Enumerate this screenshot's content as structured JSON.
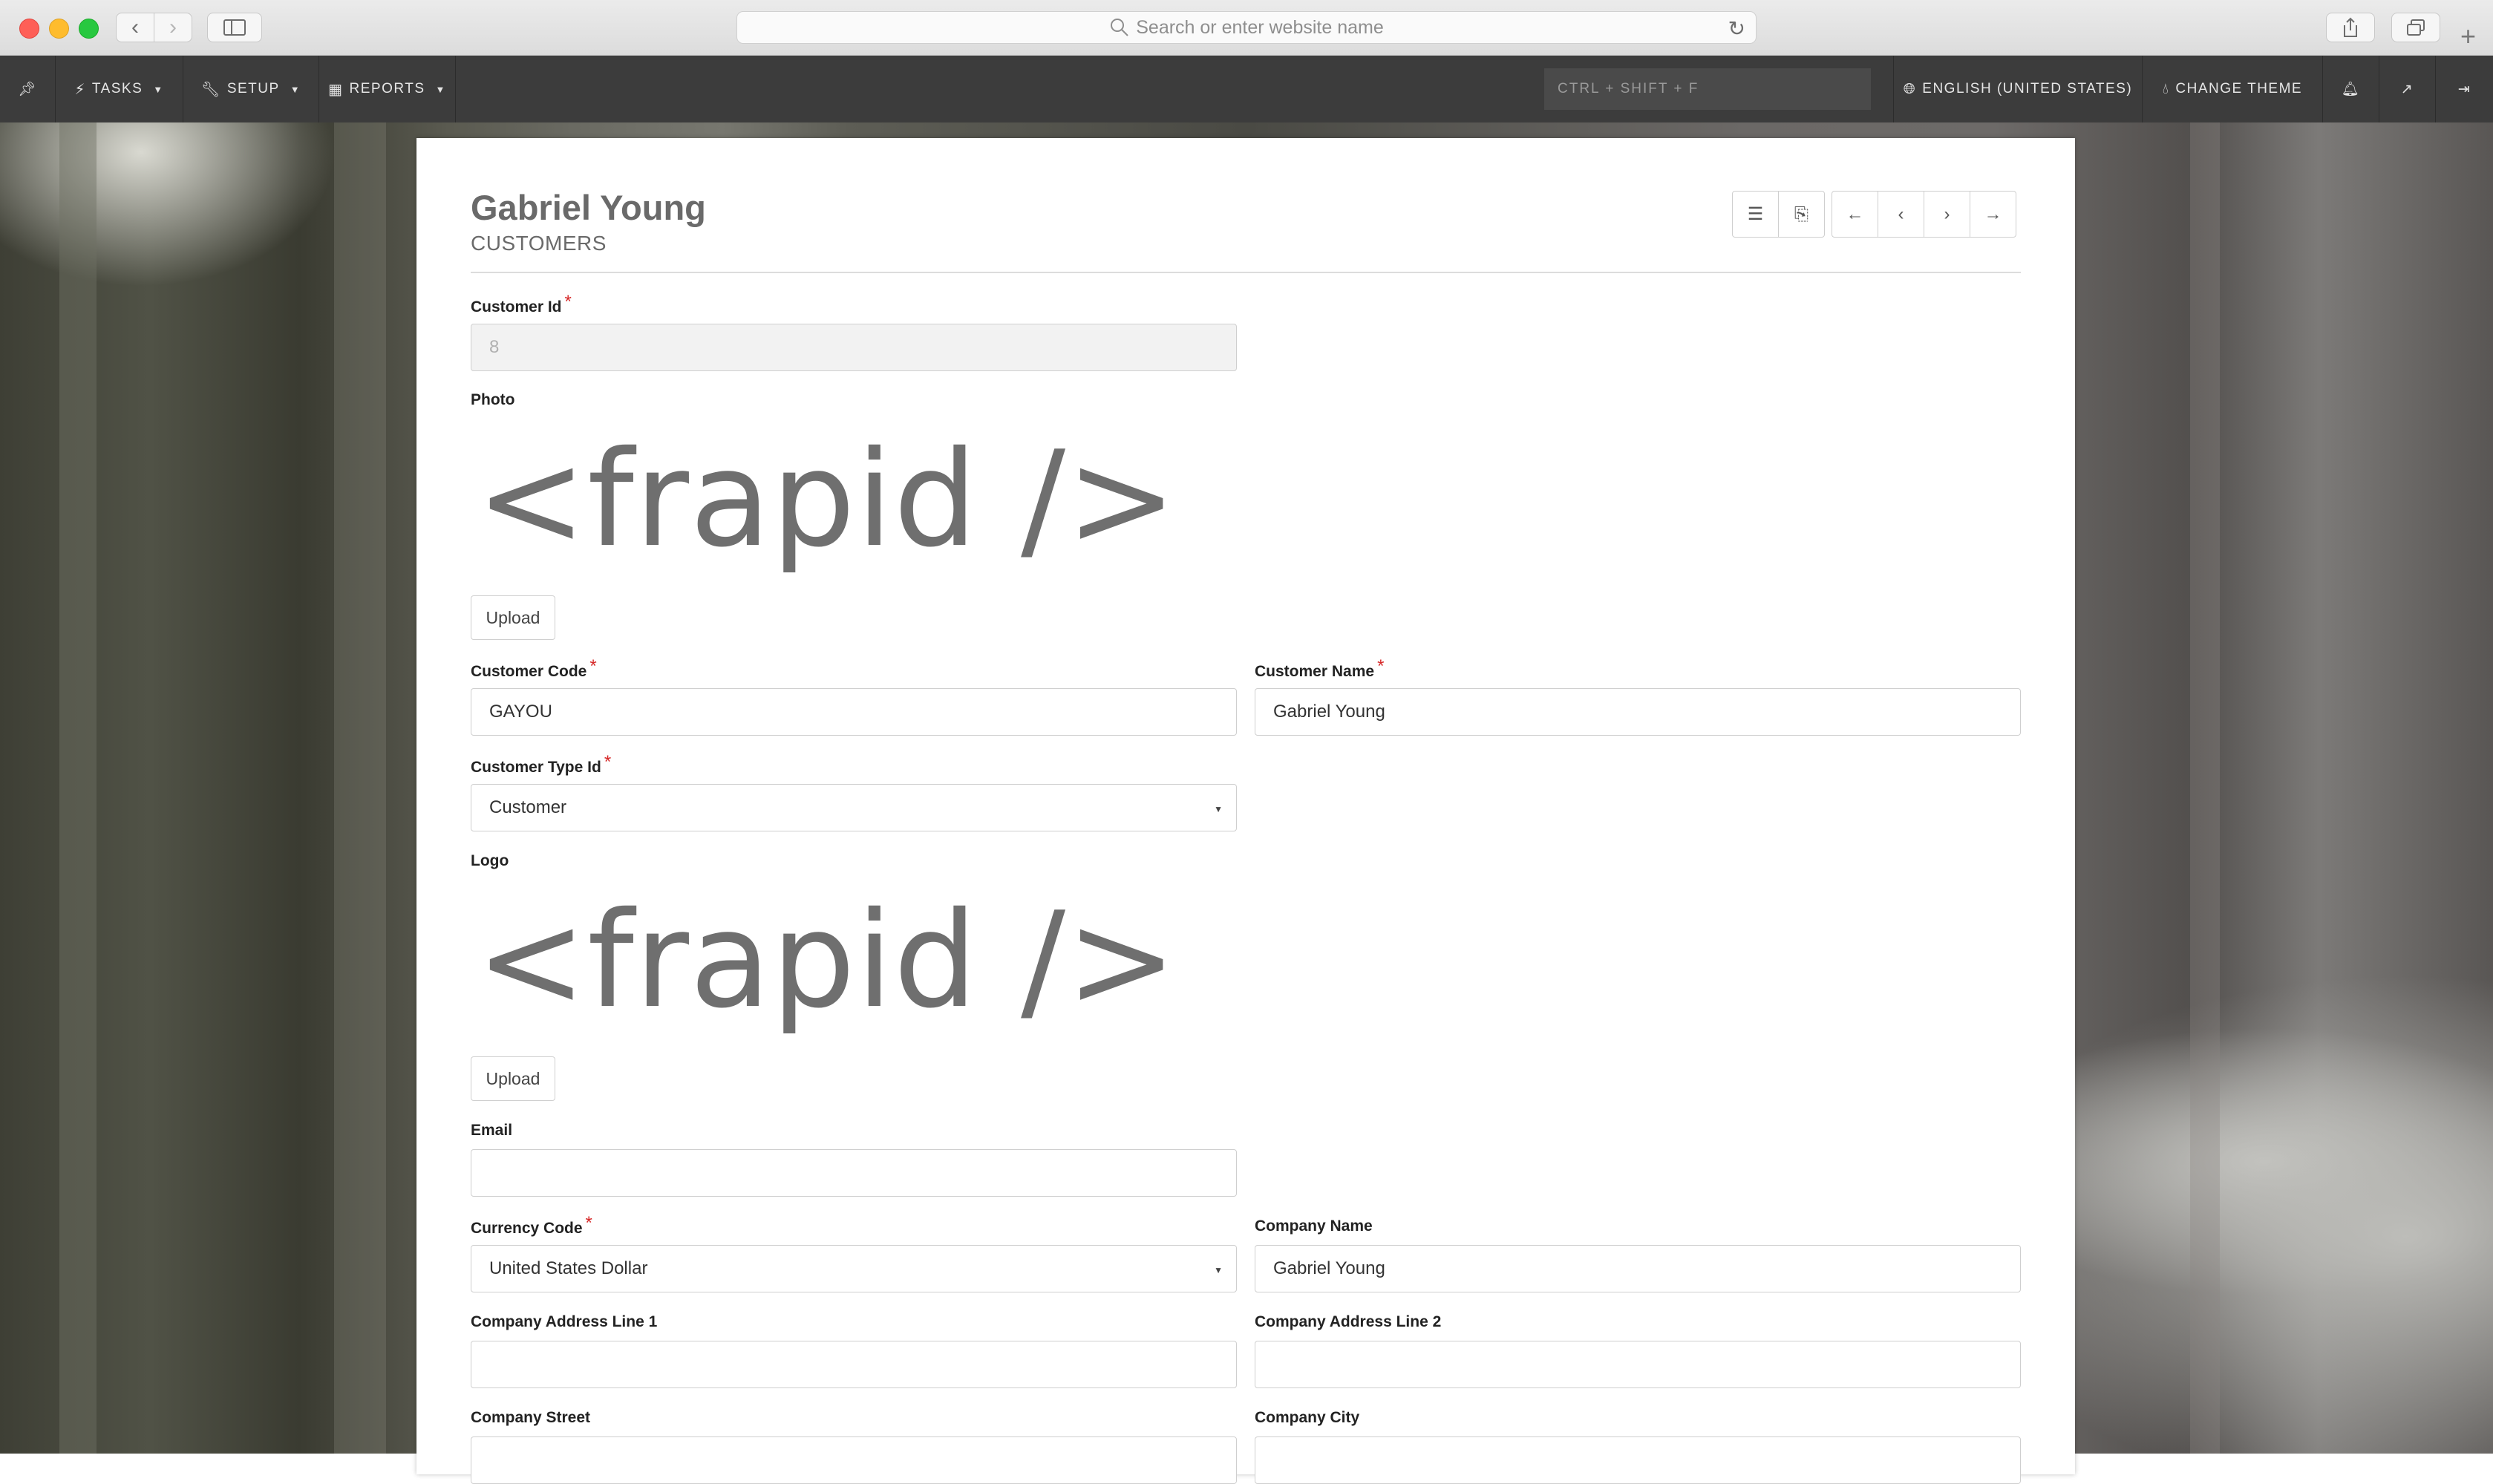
{
  "browser": {
    "address_placeholder": "Search or enter website name"
  },
  "appbar": {
    "tasks": "TASKS",
    "setup": "SETUP",
    "reports": "REPORTS",
    "search_shortcut": "CTRL + SHIFT + F",
    "language": "ENGLISH (UNITED STATES)",
    "change_theme": "CHANGE THEME"
  },
  "form": {
    "title": "Gabriel Young",
    "subtitle": "CUSTOMERS",
    "logo_text": "<frapid />",
    "upload_label": "Upload",
    "fields": {
      "customer_id": {
        "label": "Customer Id",
        "value": "8"
      },
      "photo": {
        "label": "Photo"
      },
      "customer_code": {
        "label": "Customer Code",
        "value": "GAYOU"
      },
      "customer_name": {
        "label": "Customer Name",
        "value": "Gabriel Young"
      },
      "customer_type_id": {
        "label": "Customer Type Id",
        "value": "Customer"
      },
      "logo": {
        "label": "Logo"
      },
      "email": {
        "label": "Email",
        "value": ""
      },
      "currency_code": {
        "label": "Currency Code",
        "value": "United States Dollar"
      },
      "company_name": {
        "label": "Company Name",
        "value": "Gabriel Young"
      },
      "company_address_line_1": {
        "label": "Company Address Line 1",
        "value": ""
      },
      "company_address_line_2": {
        "label": "Company Address Line 2",
        "value": ""
      },
      "company_street": {
        "label": "Company Street",
        "value": ""
      },
      "company_city": {
        "label": "Company City",
        "value": ""
      }
    }
  },
  "required_marker": "*"
}
